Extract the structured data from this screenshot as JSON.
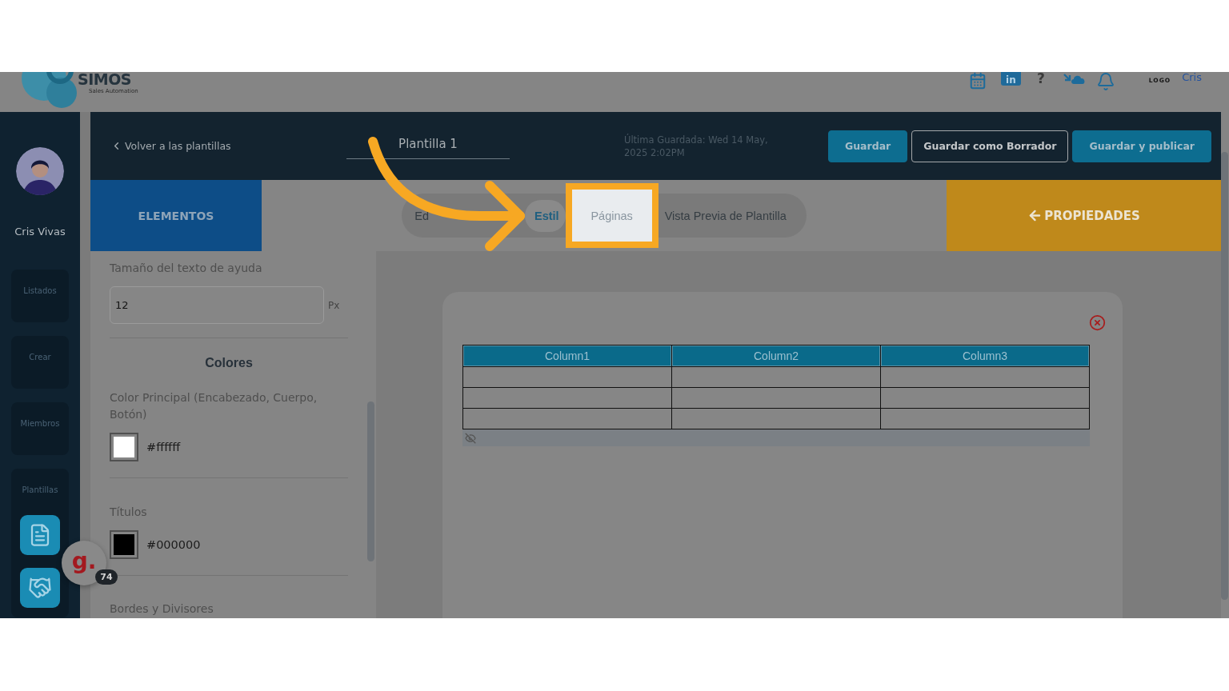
{
  "header": {
    "logo_name": "SIMOS",
    "logo_tagline": "Sales Automation",
    "social_badge": "in",
    "help_mark": "?",
    "company_logo": "LOGO",
    "user_short": "Cris"
  },
  "sidebar": {
    "user_name": "Cris Vivas",
    "items": [
      {
        "label": "Listados"
      },
      {
        "label": "Crear"
      },
      {
        "label": "Miembros"
      },
      {
        "label": "Plantillas",
        "children": [
          {
            "kind": "document"
          },
          {
            "kind": "handshake"
          }
        ]
      }
    ]
  },
  "chat_widget": {
    "letter": "g.",
    "count": "74"
  },
  "editor_bar": {
    "back_link": "Volver a las plantillas",
    "template_name": "Plantilla 1",
    "last_saved": "Última Guardada: Wed 14 May, 2025 2:02PM",
    "buttons": [
      {
        "label": "Guardar",
        "kind": "primary"
      },
      {
        "label": "Guardar como Borrador",
        "kind": "outline"
      },
      {
        "label": "Guardar y publicar",
        "kind": "primary"
      }
    ]
  },
  "elements_tab": "ELEMENTOS",
  "view_tabs": [
    {
      "label": "Ed",
      "selected": false,
      "highlighted": false
    },
    {
      "label": "Estil",
      "selected": true,
      "highlighted": false
    },
    {
      "label": "Páginas",
      "selected": false,
      "highlighted": true
    },
    {
      "label": "Vista Previa de Plantilla",
      "selected": false,
      "highlighted": false
    }
  ],
  "properties_button": "PROPIEDADES",
  "style_panel": {
    "help_text_size": {
      "label": "Tamaño del texto de ayuda",
      "value": "12",
      "unit": "Px"
    },
    "section_title": "Colores",
    "colors": [
      {
        "label": "Color Principal (Encabezado, Cuerpo, Botón)",
        "value": "#ffffff",
        "color": "#ffffff"
      },
      {
        "label": "Títulos",
        "value": "#000000",
        "color": "#000000"
      }
    ],
    "next_section": "Bordes y Divisores"
  },
  "canvas": {
    "table": {
      "columns": [
        "Column1",
        "Column2",
        "Column3"
      ],
      "rows": [
        {
          "kind": "empty"
        },
        {
          "kind": "empty"
        },
        {
          "kind": "empty"
        }
      ]
    }
  }
}
